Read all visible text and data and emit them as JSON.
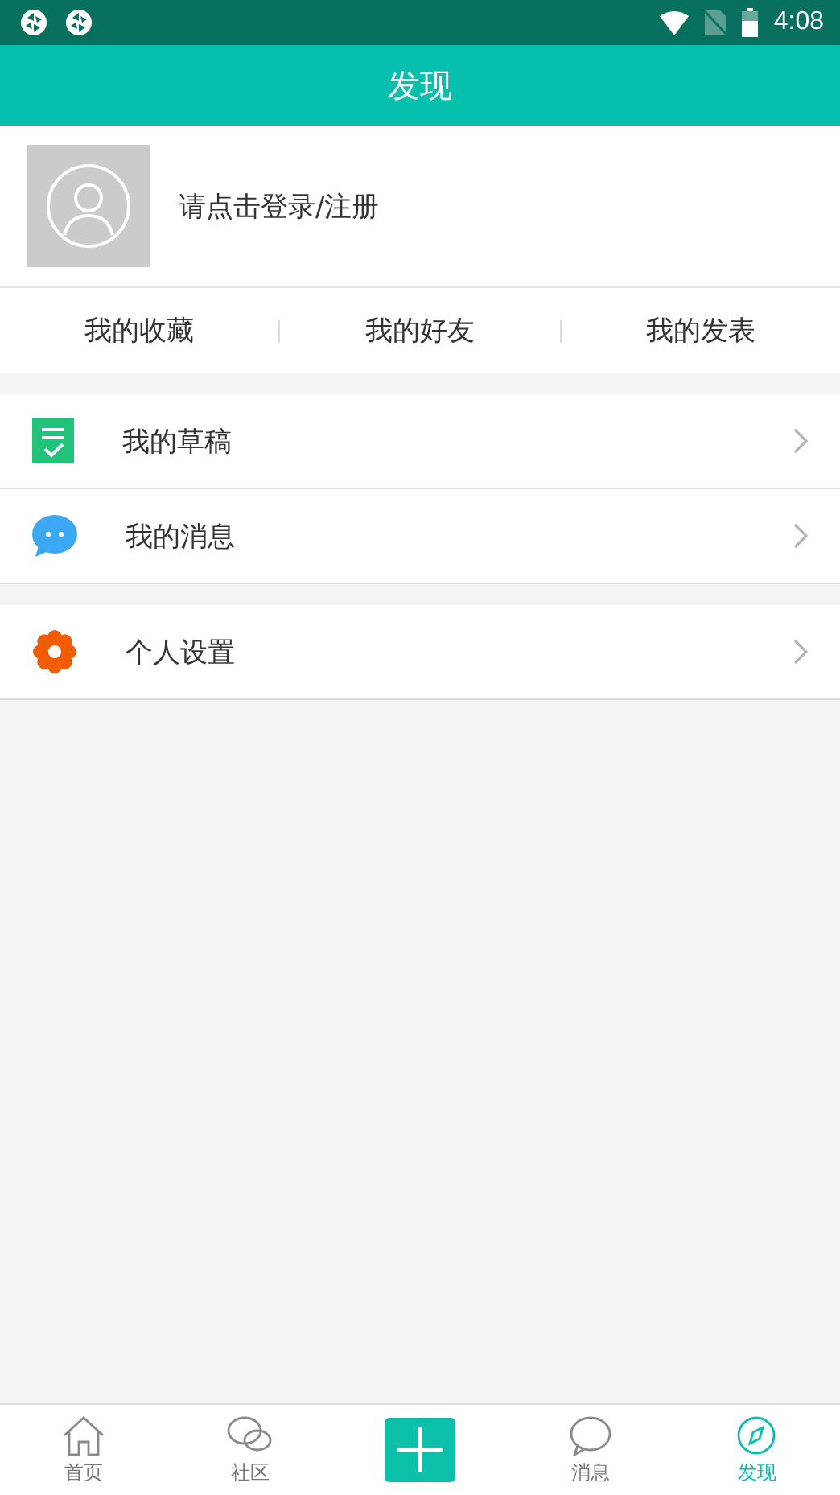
{
  "status_bar": {
    "time": "4:08"
  },
  "header": {
    "title": "发现"
  },
  "profile": {
    "login_text": "请点击登录/注册"
  },
  "shortcuts": [
    "我的收藏",
    "我的好友",
    "我的发表"
  ],
  "menu_groups": [
    [
      {
        "label": "我的草稿",
        "kind": "drafts"
      },
      {
        "label": "我的消息",
        "kind": "messages"
      }
    ],
    [
      {
        "label": "个人设置",
        "kind": "settings"
      }
    ]
  ],
  "bottom_nav": [
    {
      "label": "首页",
      "kind": "home",
      "selected": false
    },
    {
      "label": "社区",
      "kind": "community",
      "selected": false
    },
    {
      "kind": "add",
      "selected": false
    },
    {
      "label": "消息",
      "kind": "messages",
      "selected": false
    },
    {
      "label": "发现",
      "kind": "discover",
      "selected": true
    }
  ]
}
